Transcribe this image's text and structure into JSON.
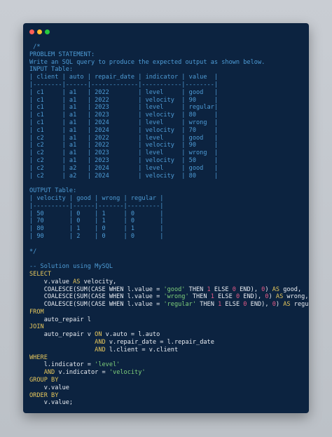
{
  "window": {
    "controls": [
      {
        "name": "close",
        "color": "#ff5f56"
      },
      {
        "name": "minimize",
        "color": "#ffbd2e"
      },
      {
        "name": "maximize",
        "color": "#27c93f"
      }
    ]
  },
  "colors": {
    "background": "#0c2340",
    "comment": "#4e9cd6",
    "keyword": "#e6c75c",
    "text": "#e8ecf2",
    "string": "#7fd07a",
    "number": "#e45a87"
  },
  "code_lines": [
    [
      {
        "t": "c",
        "v": " /*"
      }
    ],
    [
      {
        "t": "c",
        "v": "PROBLEM STATEMENT:"
      }
    ],
    [
      {
        "t": "c",
        "v": "Write an SQL query to produce the expected output as shown below."
      }
    ],
    [
      {
        "t": "c",
        "v": "INPUT Table:"
      }
    ],
    [
      {
        "t": "c",
        "v": "| client | auto | repair_date | indicator | value  |"
      }
    ],
    [
      {
        "t": "c",
        "v": "|--------|------|-------------|-----------|--------|"
      }
    ],
    [
      {
        "t": "c",
        "v": "| c1     | a1   | 2022        | level     | good   |"
      }
    ],
    [
      {
        "t": "c",
        "v": "| c1     | a1   | 2022        | velocity  | 90     |"
      }
    ],
    [
      {
        "t": "c",
        "v": "| c1     | a1   | 2023        | level     | regular|"
      }
    ],
    [
      {
        "t": "c",
        "v": "| c1     | a1   | 2023        | velocity  | 80     |"
      }
    ],
    [
      {
        "t": "c",
        "v": "| c1     | a1   | 2024        | level     | wrong  |"
      }
    ],
    [
      {
        "t": "c",
        "v": "| c1     | a1   | 2024        | velocity  | 70     |"
      }
    ],
    [
      {
        "t": "c",
        "v": "| c2     | a1   | 2022        | level     | good   |"
      }
    ],
    [
      {
        "t": "c",
        "v": "| c2     | a1   | 2022        | velocity  | 90     |"
      }
    ],
    [
      {
        "t": "c",
        "v": "| c2     | a1   | 2023        | level     | wrong  |"
      }
    ],
    [
      {
        "t": "c",
        "v": "| c2     | a1   | 2023        | velocity  | 50     |"
      }
    ],
    [
      {
        "t": "c",
        "v": "| c2     | a2   | 2024        | level     | good   |"
      }
    ],
    [
      {
        "t": "c",
        "v": "| c2     | a2   | 2024        | velocity  | 80     |"
      }
    ],
    [],
    [
      {
        "t": "c",
        "v": "OUTPUT Table:"
      }
    ],
    [
      {
        "t": "c",
        "v": "| velocity | good | wrong | regular |"
      }
    ],
    [
      {
        "t": "c",
        "v": "|----------|------|-------|---------|"
      }
    ],
    [
      {
        "t": "c",
        "v": "| 50       | 0    | 1     | 0       |"
      }
    ],
    [
      {
        "t": "c",
        "v": "| 70       | 0    | 1     | 0       |"
      }
    ],
    [
      {
        "t": "c",
        "v": "| 80       | 1    | 0     | 1       |"
      }
    ],
    [
      {
        "t": "c",
        "v": "| 90       | 2    | 0     | 0       |"
      }
    ],
    [],
    [
      {
        "t": "c",
        "v": "*/"
      }
    ],
    [],
    [
      {
        "t": "c",
        "v": "-- Solution using MySQL"
      }
    ],
    [
      {
        "t": "k",
        "v": "SELECT"
      }
    ],
    [
      {
        "t": "t",
        "v": "    v.value "
      },
      {
        "t": "k",
        "v": "AS"
      },
      {
        "t": "t",
        "v": " velocity,"
      }
    ],
    [
      {
        "t": "t",
        "v": "    COALESCE(SUM(CASE WHEN l.value = "
      },
      {
        "t": "s",
        "v": "'good'"
      },
      {
        "t": "t",
        "v": " THEN "
      },
      {
        "t": "n",
        "v": "1"
      },
      {
        "t": "t",
        "v": " ELSE "
      },
      {
        "t": "n",
        "v": "0"
      },
      {
        "t": "t",
        "v": " END), "
      },
      {
        "t": "n",
        "v": "0"
      },
      {
        "t": "t",
        "v": ") "
      },
      {
        "t": "k",
        "v": "AS"
      },
      {
        "t": "t",
        "v": " good,"
      }
    ],
    [
      {
        "t": "t",
        "v": "    COALESCE(SUM(CASE WHEN l.value = "
      },
      {
        "t": "s",
        "v": "'wrong'"
      },
      {
        "t": "t",
        "v": " THEN "
      },
      {
        "t": "n",
        "v": "1"
      },
      {
        "t": "t",
        "v": " ELSE "
      },
      {
        "t": "n",
        "v": "0"
      },
      {
        "t": "t",
        "v": " END), "
      },
      {
        "t": "n",
        "v": "0"
      },
      {
        "t": "t",
        "v": ") "
      },
      {
        "t": "k",
        "v": "AS"
      },
      {
        "t": "t",
        "v": " wrong,"
      }
    ],
    [
      {
        "t": "t",
        "v": "    COALESCE(SUM(CASE WHEN l.value = "
      },
      {
        "t": "s",
        "v": "'regular'"
      },
      {
        "t": "t",
        "v": " THEN "
      },
      {
        "t": "n",
        "v": "1"
      },
      {
        "t": "t",
        "v": " ELSE "
      },
      {
        "t": "n",
        "v": "0"
      },
      {
        "t": "t",
        "v": " END), "
      },
      {
        "t": "n",
        "v": "0"
      },
      {
        "t": "t",
        "v": ") "
      },
      {
        "t": "k",
        "v": "AS"
      },
      {
        "t": "t",
        "v": " regular"
      }
    ],
    [
      {
        "t": "k",
        "v": "FROM"
      }
    ],
    [
      {
        "t": "t",
        "v": "    auto_repair l"
      }
    ],
    [
      {
        "t": "k",
        "v": "JOIN"
      }
    ],
    [
      {
        "t": "t",
        "v": "    auto_repair v "
      },
      {
        "t": "k",
        "v": "ON"
      },
      {
        "t": "t",
        "v": " v.auto = l.auto"
      }
    ],
    [
      {
        "t": "t",
        "v": "                  "
      },
      {
        "t": "k",
        "v": "AND"
      },
      {
        "t": "t",
        "v": " v.repair_date = l.repair_date"
      }
    ],
    [
      {
        "t": "t",
        "v": "                  "
      },
      {
        "t": "k",
        "v": "AND"
      },
      {
        "t": "t",
        "v": " l.client = v.client"
      }
    ],
    [
      {
        "t": "k",
        "v": "WHERE"
      }
    ],
    [
      {
        "t": "t",
        "v": "    l.indicator = "
      },
      {
        "t": "s",
        "v": "'level'"
      }
    ],
    [
      {
        "t": "t",
        "v": "    "
      },
      {
        "t": "k",
        "v": "AND"
      },
      {
        "t": "t",
        "v": " v.indicator = "
      },
      {
        "t": "s",
        "v": "'velocity'"
      }
    ],
    [
      {
        "t": "k",
        "v": "GROUP BY"
      }
    ],
    [
      {
        "t": "t",
        "v": "    v.value"
      }
    ],
    [
      {
        "t": "k",
        "v": "ORDER BY"
      }
    ],
    [
      {
        "t": "t",
        "v": "    v.value;"
      }
    ]
  ]
}
